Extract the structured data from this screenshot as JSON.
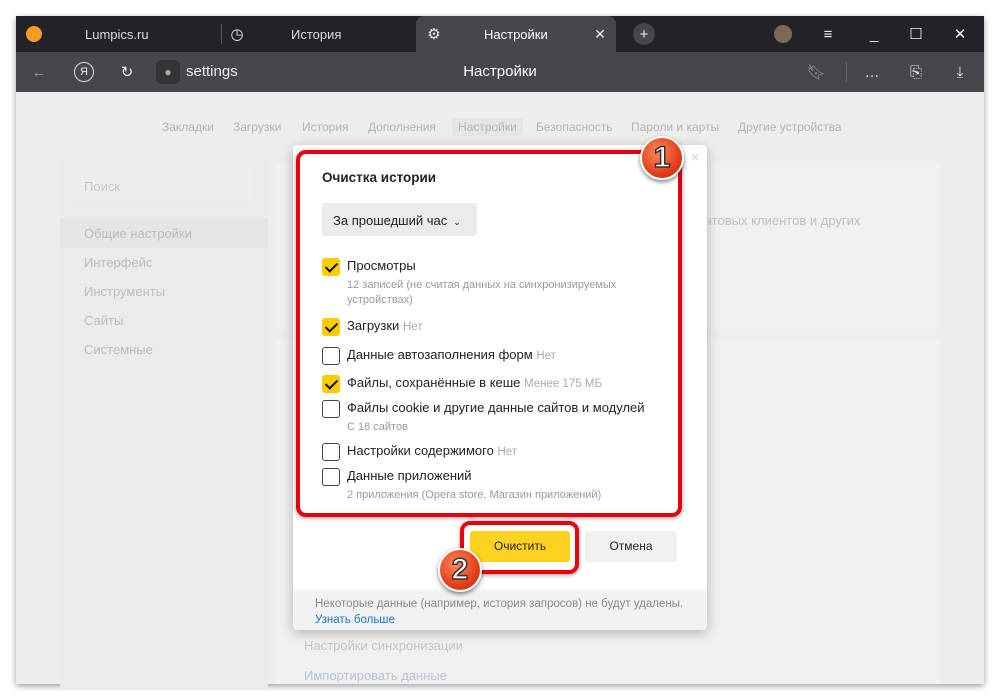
{
  "tabs": [
    {
      "label": "Lumpics.ru",
      "icon": "orange-icon"
    },
    {
      "label": "История",
      "icon": "clock-icon"
    },
    {
      "label": "Настройки",
      "icon": "gear-icon",
      "active": true
    }
  ],
  "address": {
    "url": "settings",
    "title": "Настройки"
  },
  "settings_nav": [
    "Закладки",
    "Загрузки",
    "История",
    "Дополнения",
    "Настройки",
    "Безопасность",
    "Пароли и карты",
    "Другие устройства"
  ],
  "sidebar": {
    "search_placeholder": "Поиск",
    "items": [
      "Общие настройки",
      "Интерфейс",
      "Инструменты",
      "Сайты",
      "Системные"
    ]
  },
  "background": {
    "partial_text": "чтовых клиентов и других",
    "sync": "Настройки синхронизации",
    "import": "Импортировать данные"
  },
  "dialog": {
    "title": "Очистка истории",
    "period": "За прошедший час",
    "items": [
      {
        "label": "Просмотры",
        "meta": "",
        "sub": "12 записей (не считая данных на синхронизируемых",
        "sub2": "устройствах)",
        "checked": true
      },
      {
        "label": "Загрузки",
        "meta": "Нет",
        "checked": true
      },
      {
        "label": "Данные автозаполнения форм",
        "meta": "Нет",
        "checked": false
      },
      {
        "label": "Файлы, сохранённые в кеше",
        "meta": "Менее 175 МБ",
        "checked": true
      },
      {
        "label": "Файлы cookie и другие данные сайтов и модулей",
        "meta": "",
        "sub": "С 18 сайтов",
        "checked": false
      },
      {
        "label": "Настройки содержимого",
        "meta": "Нет",
        "checked": false
      },
      {
        "label": "Данные приложений",
        "meta": "",
        "sub": "2 приложения (Opera store, Магазин приложений)",
        "checked": false
      }
    ],
    "clear_label": "Очистить",
    "cancel_label": "Отмена",
    "footer_note": "Некоторые данные (например, история запросов) не будут удалены.",
    "learn_more": "Узнать больше",
    "close": "×"
  },
  "annotations": {
    "badge1": "1",
    "badge2": "2"
  },
  "colors": {
    "accent": "#ffcc00",
    "highlight": "#e8000b",
    "link": "#1a73d9"
  }
}
